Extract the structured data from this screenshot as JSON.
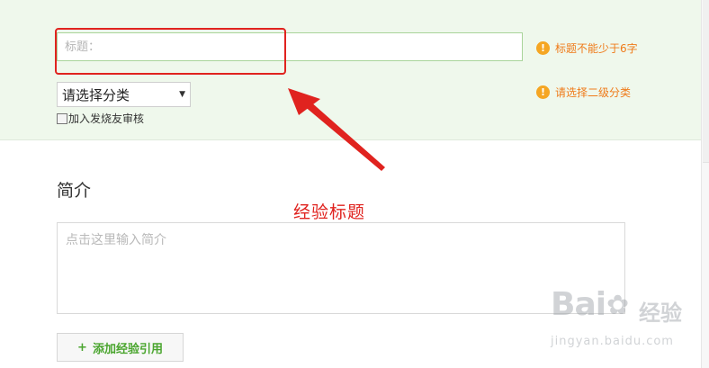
{
  "form": {
    "title_placeholder": "标题：",
    "title_value": "",
    "title_hint": "标题不能少于6字",
    "category_selected": "请选择分类",
    "category_hint": "请选择二级分类",
    "review_checkbox_label": "加入发烧友审核",
    "review_checked": false
  },
  "intro": {
    "heading": "简介",
    "placeholder": "点击这里输入简介"
  },
  "annotation": {
    "label": "经验标题",
    "color": "#e0231f"
  },
  "buttons": {
    "add_reference_plus": "+",
    "add_reference_label": "添加经验引用"
  },
  "watermark": {
    "logo_text": "Bai",
    "logo_suffix": "经验",
    "url": "jingyan.baidu.com"
  },
  "colors": {
    "panel_bg": "#eff8ec",
    "hint_orange": "#ef7b1a",
    "accent_green": "#4aa52e",
    "annotation_red": "#e0231f"
  },
  "icons": {
    "warning": "warning-icon",
    "dropdown": "chevron-down-icon"
  }
}
